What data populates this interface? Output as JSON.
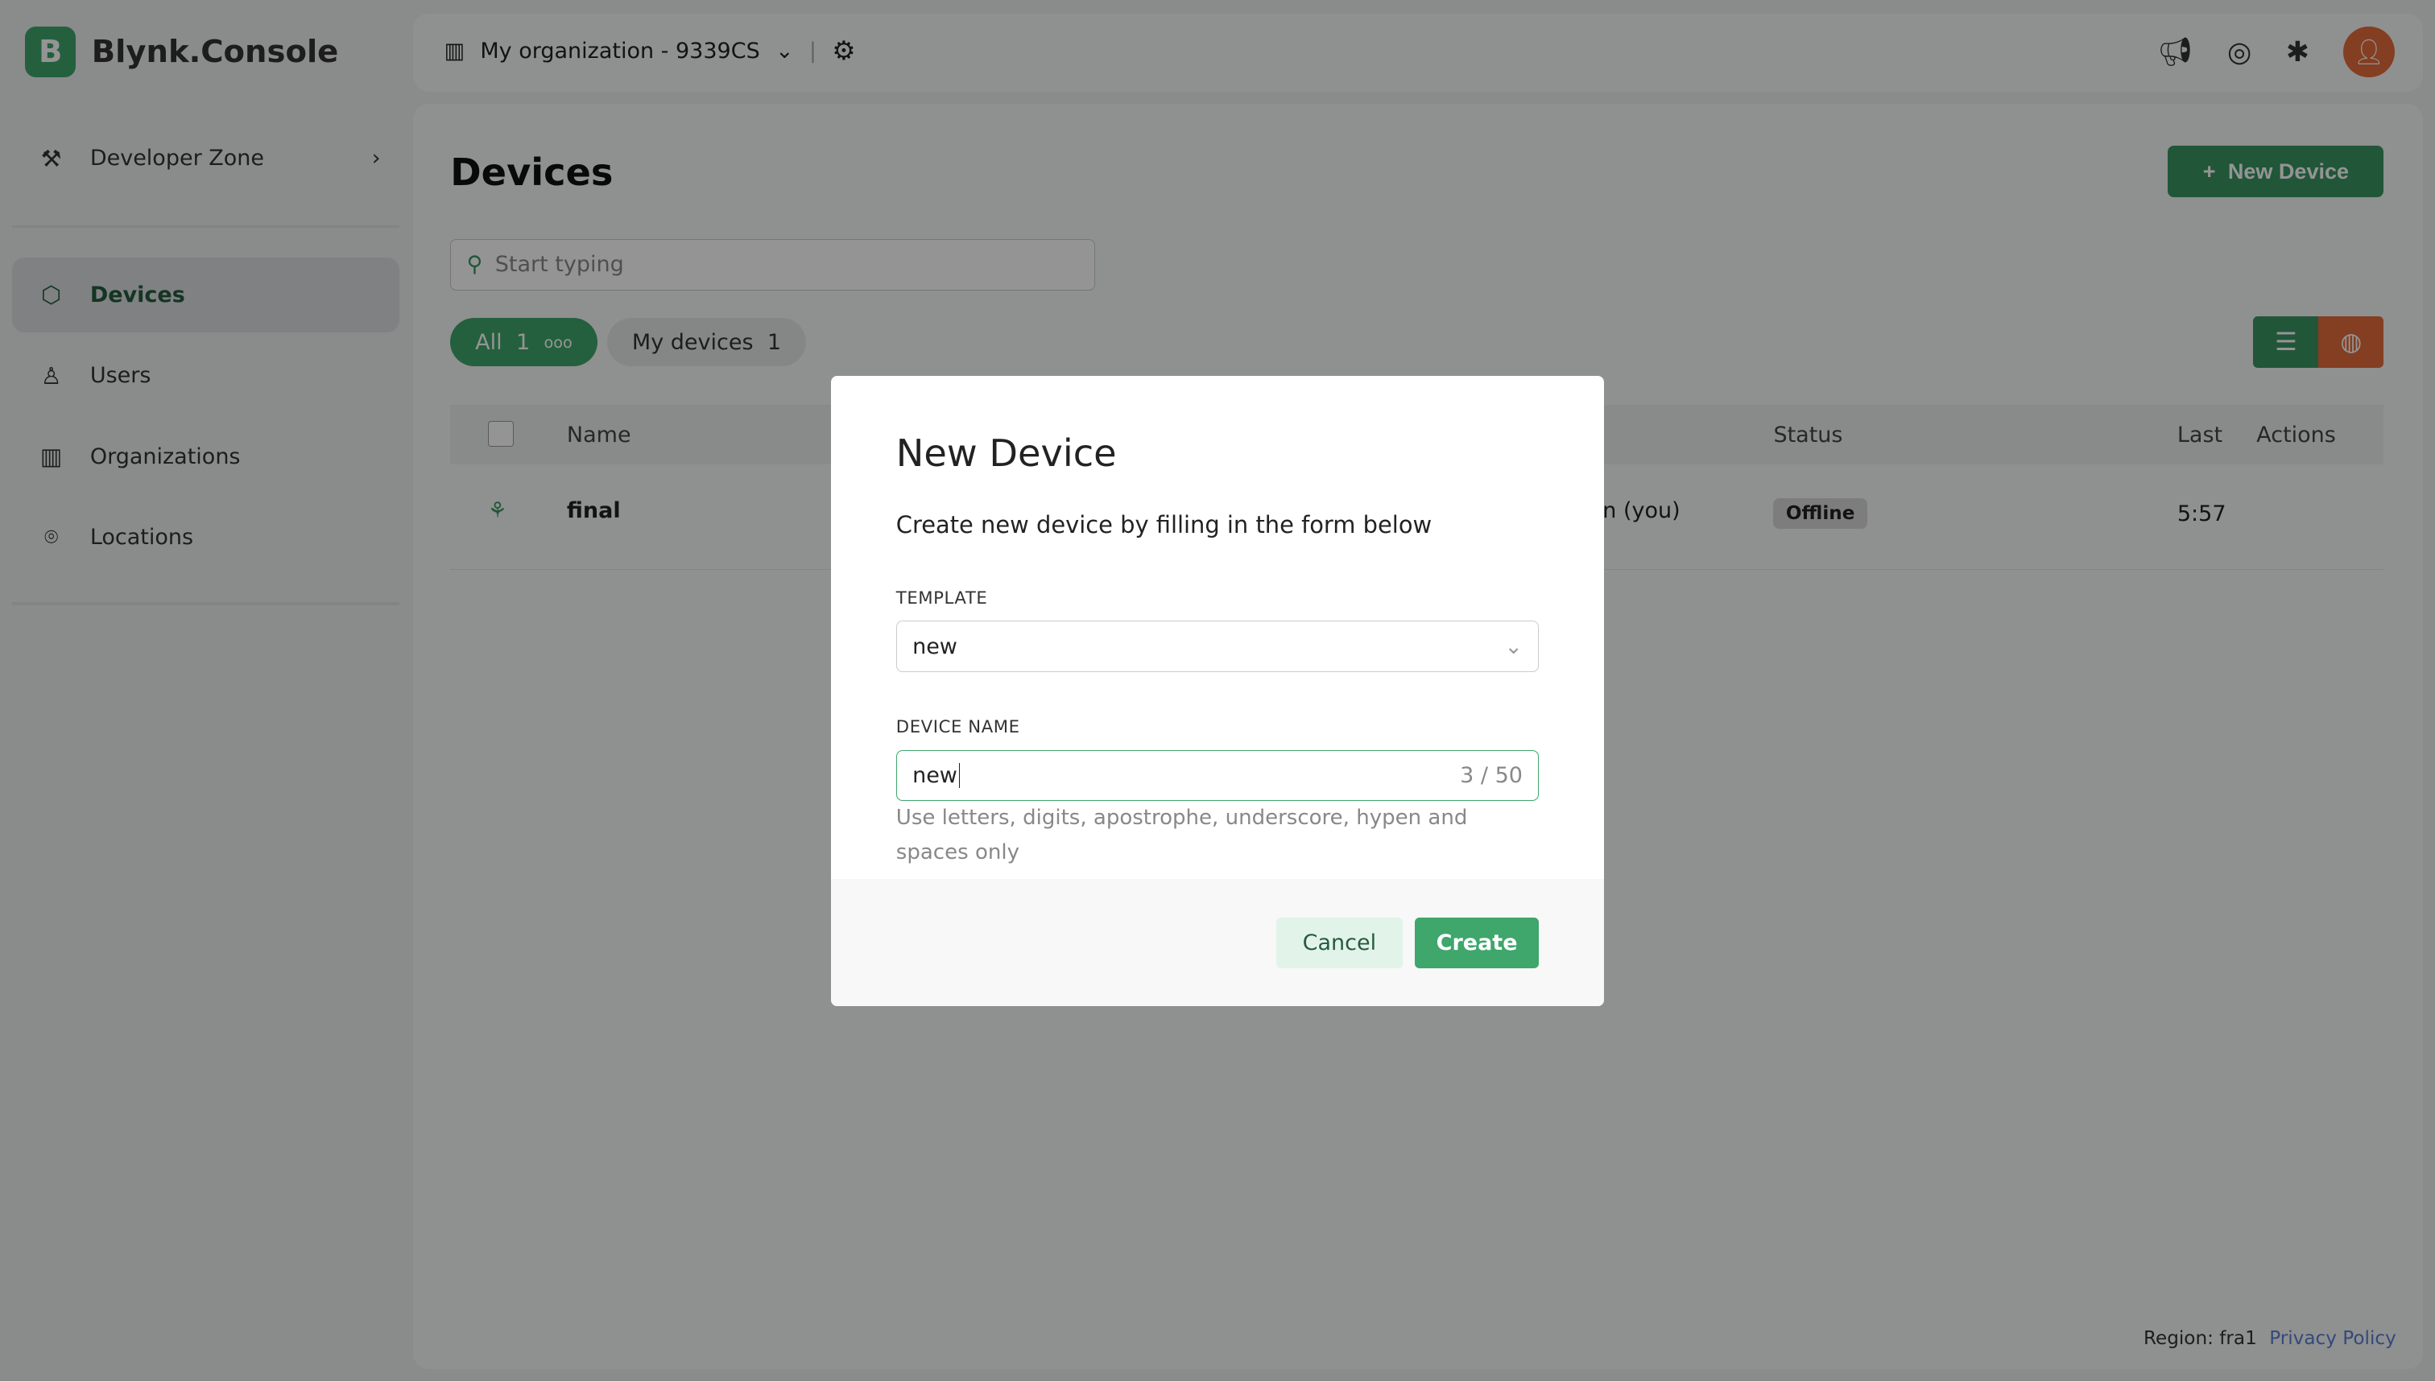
{
  "app": {
    "logo_letter": "B",
    "name": "Blynk.Console"
  },
  "topbar": {
    "org": "My organization - 9339CS",
    "icons": [
      "megaphone-icon",
      "lifebuoy-icon",
      "bug-icon",
      "avatar"
    ]
  },
  "sidebar": {
    "developer_zone": "Developer Zone",
    "items": [
      {
        "label": "Devices",
        "active": true
      },
      {
        "label": "Users"
      },
      {
        "label": "Organizations"
      },
      {
        "label": "Locations"
      }
    ]
  },
  "main": {
    "title": "Devices",
    "new_device": "New Device",
    "search_placeholder": "Start typing",
    "chips": {
      "all": "All",
      "all_count": "1",
      "mine": "My devices",
      "mine_count": "1"
    },
    "table": {
      "headers": [
        "Name",
        "Status",
        "Last",
        "Actions"
      ],
      "rows": [
        {
          "name": "final",
          "owner": "n (you)",
          "status": "Offline",
          "last": "5:57"
        }
      ]
    }
  },
  "footer": {
    "region": "Region: fra1",
    "privacy": "Privacy Policy"
  },
  "modal": {
    "title": "New Device",
    "subtitle": "Create new device by filling in the form below",
    "template_label": "TEMPLATE",
    "template_value": "new",
    "name_label": "DEVICE NAME",
    "name_value": "new",
    "counter": "3 / 50",
    "hint": "Use letters, digits, apostrophe, underscore, hypen and spaces only",
    "cancel": "Cancel",
    "create": "Create"
  },
  "colors": {
    "accent": "#3fa66c",
    "avatar": "#e46c3b"
  }
}
